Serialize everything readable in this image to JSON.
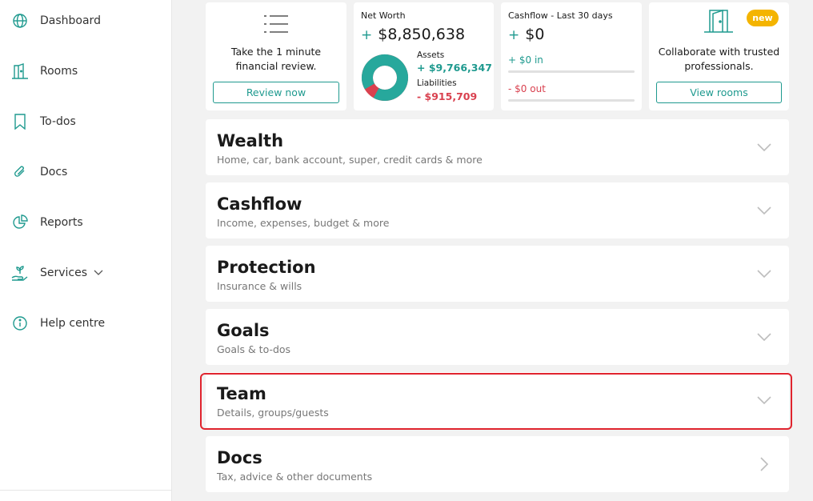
{
  "sidebar": {
    "items": [
      {
        "label": "Dashboard",
        "icon": "globe-icon"
      },
      {
        "label": "Rooms",
        "icon": "door-icon"
      },
      {
        "label": "To-dos",
        "icon": "bookmark-icon"
      },
      {
        "label": "Docs",
        "icon": "paperclip-icon"
      },
      {
        "label": "Reports",
        "icon": "pie-chart-icon"
      },
      {
        "label": "Services",
        "icon": "hand-plant-icon"
      },
      {
        "label": "Help centre",
        "icon": "info-icon"
      }
    ]
  },
  "cards": {
    "review": {
      "text": "Take the 1 minute financial review.",
      "button": "Review now",
      "icon": "list-icon"
    },
    "networth": {
      "title": "Net Worth",
      "value_sign": "+",
      "value": "$8,850,638",
      "assets_label": "Assets",
      "assets_value": "+ $9,766,347",
      "liabilities_label": "Liabilities",
      "liabilities_value": "- $915,709",
      "assets_fraction": 0.914
    },
    "cashflow": {
      "title": "Cashflow - Last 30 days",
      "value_sign": "+",
      "value": "$0",
      "in_amount": "+ $0",
      "in_label": "in",
      "out_amount": "- $0",
      "out_label": "out"
    },
    "rooms": {
      "badge": "new",
      "text": "Collaborate with trusted professionals.",
      "button": "View rooms",
      "icon": "door-icon"
    }
  },
  "sections": [
    {
      "title": "Wealth",
      "subtitle": "Home, car, bank account, super, credit cards & more",
      "chevron": "chevron-down"
    },
    {
      "title": "Cashflow",
      "subtitle": "Income, expenses, budget & more",
      "chevron": "chevron-down"
    },
    {
      "title": "Protection",
      "subtitle": "Insurance & wills",
      "chevron": "chevron-down"
    },
    {
      "title": "Goals",
      "subtitle": "Goals & to-dos",
      "chevron": "chevron-down"
    },
    {
      "title": "Team",
      "subtitle": "Details, groups/guests",
      "chevron": "chevron-down"
    },
    {
      "title": "Docs",
      "subtitle": "Tax, advice & other documents",
      "chevron": "chevron-right"
    }
  ],
  "colors": {
    "accent": "#1f9a8f",
    "negative": "#d9414f",
    "badge": "#f4b400",
    "highlight": "#e0242e"
  }
}
